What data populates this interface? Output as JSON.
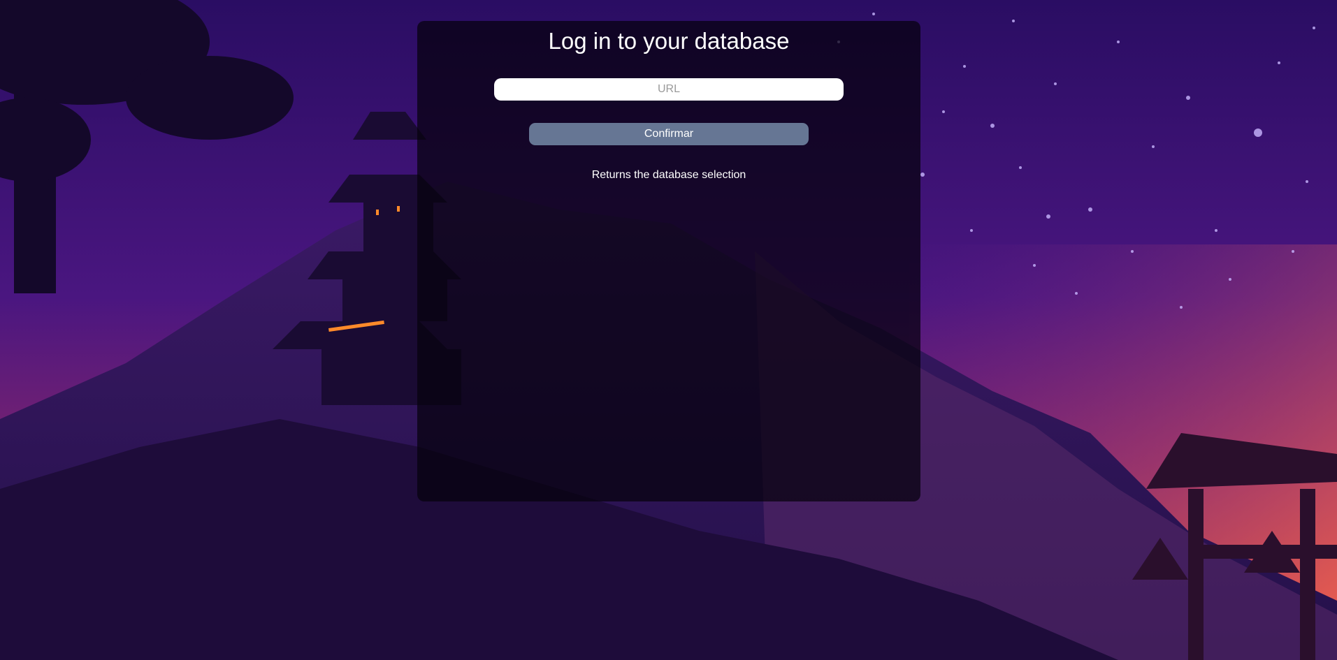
{
  "login": {
    "title": "Log in to your database",
    "url_placeholder": "URL",
    "url_value": "",
    "confirm_label": "Confirmar",
    "return_label": "Returns the database selection"
  },
  "colors": {
    "panel_overlay": "#05020c",
    "button": "#667694",
    "input": "#ffffff",
    "text": "#ffffff"
  }
}
